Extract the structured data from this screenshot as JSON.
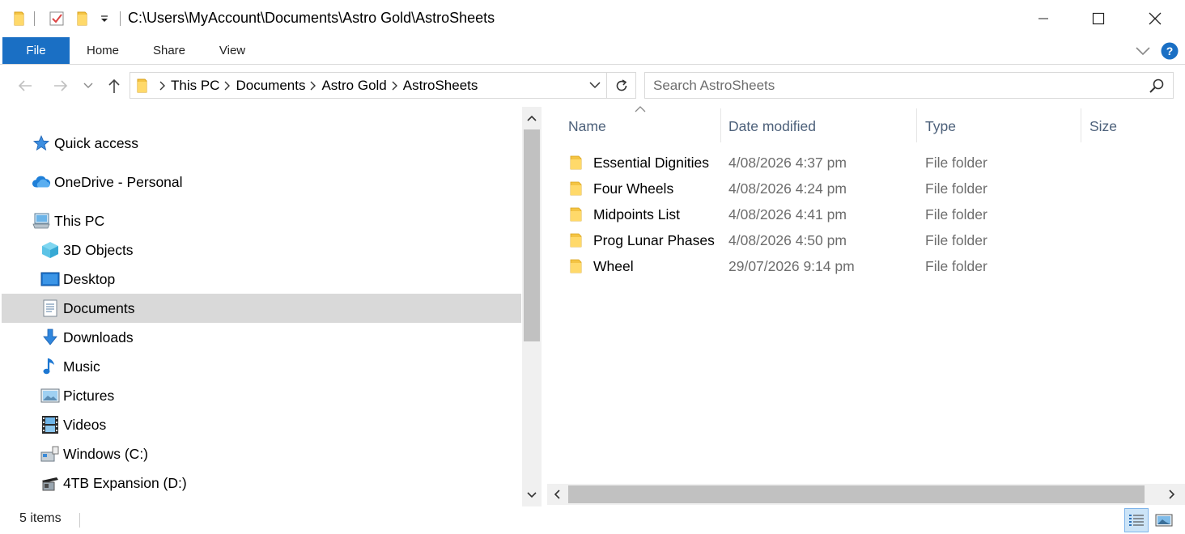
{
  "window": {
    "title_path": "C:\\Users\\MyAccount\\Documents\\Astro Gold\\AstroSheets",
    "minimize_icon": "minimize-icon",
    "maximize_icon": "maximize-icon",
    "close_icon": "close-icon"
  },
  "ribbon": {
    "tabs": [
      {
        "label": "File"
      },
      {
        "label": "Home"
      },
      {
        "label": "Share"
      },
      {
        "label": "View"
      }
    ],
    "accent": "#1a6fc4",
    "help_color": "#1a6fc4"
  },
  "address": {
    "crumbs": [
      "This PC",
      "Documents",
      "Astro Gold",
      "AstroSheets"
    ]
  },
  "search": {
    "placeholder": "Search AstroSheets",
    "value": ""
  },
  "nav": {
    "items": [
      {
        "label": "Quick access",
        "icon": "star-icon"
      },
      {
        "label": "OneDrive - Personal",
        "icon": "cloud-icon"
      },
      {
        "label": "This PC",
        "icon": "computer-icon"
      },
      {
        "label": "3D Objects",
        "icon": "cube-icon"
      },
      {
        "label": "Desktop",
        "icon": "desktop-icon"
      },
      {
        "label": "Documents",
        "icon": "document-icon",
        "selected": true
      },
      {
        "label": "Downloads",
        "icon": "download-arrow-icon"
      },
      {
        "label": "Music",
        "icon": "music-note-icon"
      },
      {
        "label": "Pictures",
        "icon": "picture-icon"
      },
      {
        "label": "Videos",
        "icon": "film-icon"
      },
      {
        "label": "Windows (C:)",
        "icon": "drive-icon"
      },
      {
        "label": "4TB Expansion (D:)",
        "icon": "external-drive-icon"
      }
    ],
    "selected_color": "#d9d9d9"
  },
  "content": {
    "columns": [
      "Name",
      "Date modified",
      "Type",
      "Size"
    ],
    "header_color": "#4c607a",
    "rows": [
      {
        "name": "Essential Dignities",
        "date": "4/08/2026 4:37 pm",
        "type": "File folder",
        "size": ""
      },
      {
        "name": "Four Wheels",
        "date": "4/08/2026 4:24 pm",
        "type": "File folder",
        "size": ""
      },
      {
        "name": "Midpoints List",
        "date": "4/08/2026 4:41 pm",
        "type": "File folder",
        "size": ""
      },
      {
        "name": "Prog Lunar Phases",
        "date": "4/08/2026 4:50 pm",
        "type": "File folder",
        "size": ""
      },
      {
        "name": "Wheel",
        "date": "29/07/2026 9:14 pm",
        "type": "File folder",
        "size": ""
      }
    ]
  },
  "status": {
    "item_count": "5 items"
  }
}
